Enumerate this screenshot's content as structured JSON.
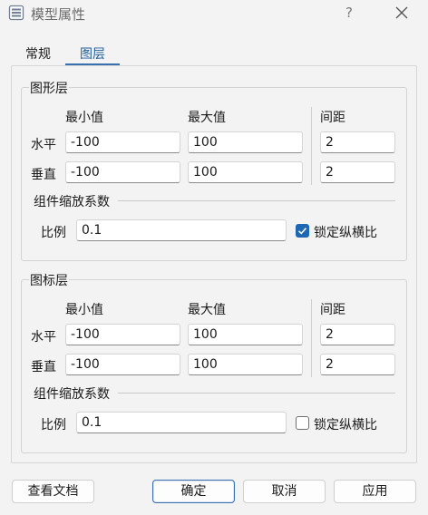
{
  "window": {
    "title": "模型属性",
    "help": "?"
  },
  "tabs": [
    {
      "label": "常规"
    },
    {
      "label": "图层"
    }
  ],
  "column_headers": {
    "min": "最小值",
    "max": "最大值",
    "spacing": "间距"
  },
  "row_labels": {
    "horizontal": "水平",
    "vertical": "垂直",
    "ratio": "比例"
  },
  "groups": [
    {
      "title": "图形层",
      "horizontal": {
        "min": "-100",
        "max": "100",
        "spacing": "2"
      },
      "vertical": {
        "min": "-100",
        "max": "100",
        "spacing": "2"
      },
      "scale_title": "组件缩放系数",
      "ratio": "0.1",
      "lock_label": "锁定纵横比",
      "lock_checked": true
    },
    {
      "title": "图标层",
      "horizontal": {
        "min": "-100",
        "max": "100",
        "spacing": "2"
      },
      "vertical": {
        "min": "-100",
        "max": "100",
        "spacing": "2"
      },
      "scale_title": "组件缩放系数",
      "ratio": "0.1",
      "lock_label": "锁定纵横比",
      "lock_checked": false
    }
  ],
  "footer": {
    "docs": "查看文档",
    "ok": "确定",
    "cancel": "取消",
    "apply": "应用"
  },
  "colors": {
    "accent": "#1f66b3",
    "tab_active": "#1f5fa0"
  },
  "icons": {
    "app": "model-window-icon",
    "close": "close-icon"
  }
}
